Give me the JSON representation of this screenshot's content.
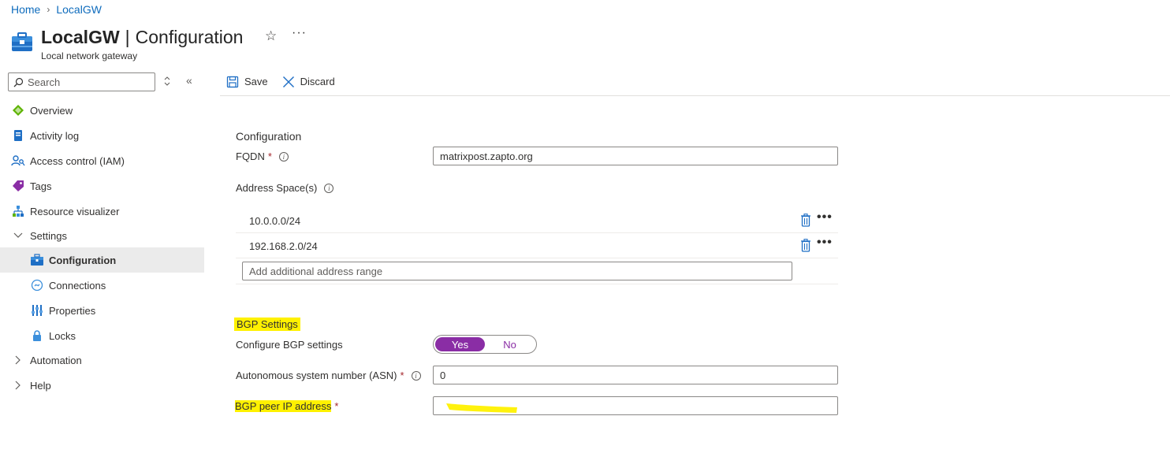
{
  "breadcrumb": {
    "home": "Home",
    "current": "LocalGW"
  },
  "header": {
    "resource_name": "LocalGW",
    "separator": "|",
    "page_name": "Configuration",
    "subtitle": "Local network gateway",
    "star_icon": "star-icon",
    "more_label": "···"
  },
  "sidebar": {
    "search_placeholder": "Search",
    "items": [
      {
        "label": "Overview",
        "icon": "overview-icon"
      },
      {
        "label": "Activity log",
        "icon": "activity-log-icon"
      },
      {
        "label": "Access control (IAM)",
        "icon": "iam-icon"
      },
      {
        "label": "Tags",
        "icon": "tag-icon"
      },
      {
        "label": "Resource visualizer",
        "icon": "visualizer-icon"
      }
    ],
    "settings_group": "Settings",
    "settings_items": [
      {
        "label": "Configuration",
        "icon": "configuration-icon",
        "active": true
      },
      {
        "label": "Connections",
        "icon": "connections-icon"
      },
      {
        "label": "Properties",
        "icon": "properties-icon"
      },
      {
        "label": "Locks",
        "icon": "lock-icon"
      }
    ],
    "automation_group": "Automation",
    "help_group": "Help"
  },
  "toolbar": {
    "save_label": "Save",
    "discard_label": "Discard"
  },
  "form": {
    "section_title": "Configuration",
    "fqdn_label": "FQDN",
    "fqdn_value": "matrixpost.zapto.org",
    "address_space_label": "Address Space(s)",
    "address_spaces": [
      "10.0.0.0/24",
      "192.168.2.0/24"
    ],
    "add_range_placeholder": "Add additional address range",
    "bgp_section_title": "BGP Settings",
    "configure_bgp_label": "Configure BGP settings",
    "bgp_yes": "Yes",
    "bgp_no": "No",
    "bgp_selected": "Yes",
    "asn_label": "Autonomous system number (ASN)",
    "asn_value": "0",
    "bgp_peer_label": "BGP peer IP address",
    "bgp_peer_value": "",
    "required_marker": "*"
  },
  "colors": {
    "link": "#0f6cbd",
    "toggle_accent": "#8a2da5",
    "highlight": "#fff100",
    "required": "#a4262c"
  }
}
